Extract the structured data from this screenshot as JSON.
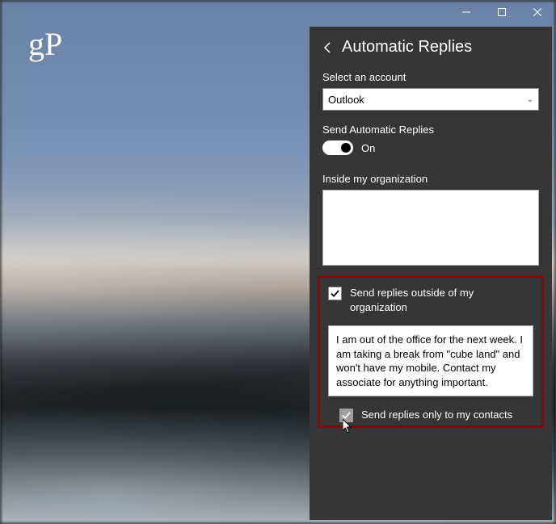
{
  "watermark": "gP",
  "titlebar": {
    "minimize": "minimize-icon",
    "maximize": "maximize-icon",
    "close": "close-icon"
  },
  "panel": {
    "title": "Automatic Replies",
    "account_label": "Select an account",
    "account_value": "Outlook",
    "toggle_label": "Send Automatic Replies",
    "toggle_state": "On",
    "inside_label": "Inside my organization",
    "outside_checkbox_label": "Send replies outside of my organization",
    "outside_message": "I am out of the office for the next week. I am taking a break from \"cube land\" and won't have my mobile. Contact my associate for anything important.",
    "contacts_only_label": "Send replies only to my contacts"
  }
}
